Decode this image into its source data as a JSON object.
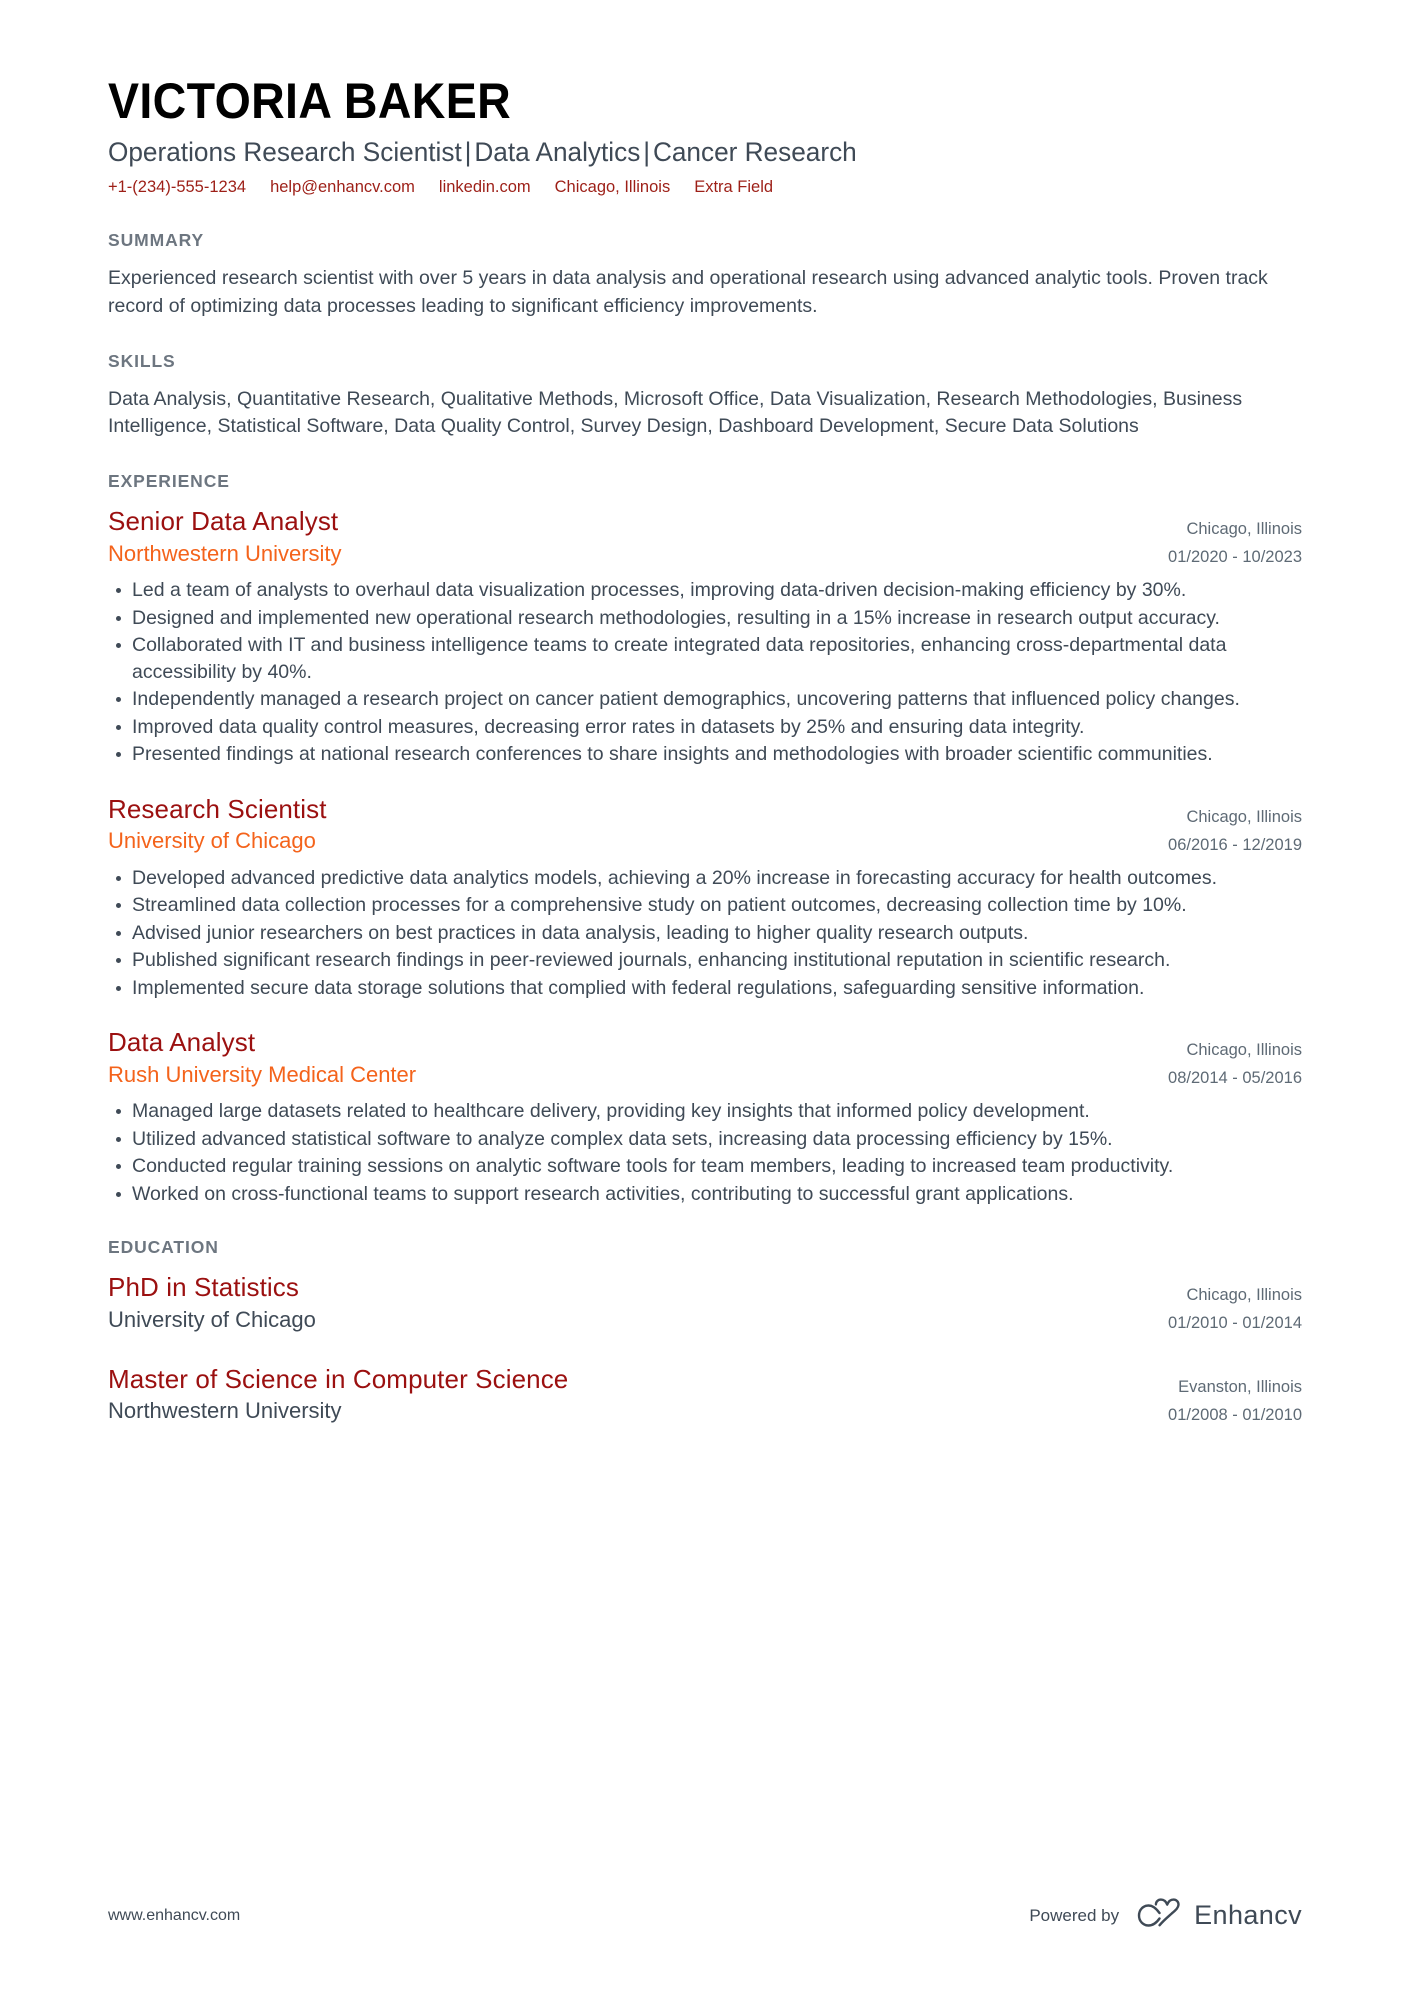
{
  "header": {
    "name": "VICTORIA BAKER",
    "headline_parts": [
      "Operations Research Scientist",
      "Data Analytics",
      "Cancer Research"
    ],
    "headline_separator": "|",
    "contacts": [
      "+1-(234)-555-1234",
      "help@enhancv.com",
      "linkedin.com",
      "Chicago, Illinois",
      "Extra Field"
    ]
  },
  "summary": {
    "title": "SUMMARY",
    "text": "Experienced research scientist with over 5 years in data analysis and operational research using advanced analytic tools. Proven track record of optimizing data processes leading to significant efficiency improvements."
  },
  "skills": {
    "title": "SKILLS",
    "text": "Data Analysis, Quantitative Research, Qualitative Methods, Microsoft Office, Data Visualization, Research Methodologies, Business Intelligence, Statistical Software, Data Quality Control, Survey Design, Dashboard Development, Secure Data Solutions"
  },
  "experience": {
    "title": "EXPERIENCE",
    "entries": [
      {
        "position": "Senior Data Analyst",
        "organization": "Northwestern University",
        "location": "Chicago, Illinois",
        "dates": "01/2020 - 10/2023",
        "bullets": [
          "Led a team of analysts to overhaul data visualization processes, improving data-driven decision-making efficiency by 30%.",
          "Designed and implemented new operational research methodologies, resulting in a 15% increase in research output accuracy.",
          "Collaborated with IT and business intelligence teams to create integrated data repositories, enhancing cross-departmental data accessibility by 40%.",
          "Independently managed a research project on cancer patient demographics, uncovering patterns that influenced policy changes.",
          "Improved data quality control measures, decreasing error rates in datasets by 25% and ensuring data integrity.",
          "Presented findings at national research conferences to share insights and methodologies with broader scientific communities."
        ]
      },
      {
        "position": "Research Scientist",
        "organization": "University of Chicago",
        "location": "Chicago, Illinois",
        "dates": "06/2016 - 12/2019",
        "bullets": [
          "Developed advanced predictive data analytics models, achieving a 20% increase in forecasting accuracy for health outcomes.",
          "Streamlined data collection processes for a comprehensive study on patient outcomes, decreasing collection time by 10%.",
          "Advised junior researchers on best practices in data analysis, leading to higher quality research outputs.",
          "Published significant research findings in peer-reviewed journals, enhancing institutional reputation in scientific research.",
          "Implemented secure data storage solutions that complied with federal regulations, safeguarding sensitive information."
        ]
      },
      {
        "position": "Data Analyst",
        "organization": "Rush University Medical Center",
        "location": "Chicago, Illinois",
        "dates": "08/2014 - 05/2016",
        "bullets": [
          "Managed large datasets related to healthcare delivery, providing key insights that informed policy development.",
          "Utilized advanced statistical software to analyze complex data sets, increasing data processing efficiency by 15%.",
          "Conducted regular training sessions on analytic software tools for team members, leading to increased team productivity.",
          "Worked on cross-functional teams to support research activities, contributing to successful grant applications."
        ]
      }
    ]
  },
  "education": {
    "title": "EDUCATION",
    "entries": [
      {
        "degree": "PhD in Statistics",
        "institution": "University of Chicago",
        "location": "Chicago, Illinois",
        "dates": "01/2010 - 01/2014"
      },
      {
        "degree": "Master of Science in Computer Science",
        "institution": "Northwestern University",
        "location": "Evanston, Illinois",
        "dates": "01/2008 - 01/2010"
      }
    ]
  },
  "footer": {
    "url": "www.enhancv.com",
    "powered_by": "Powered by",
    "brand": "Enhancv"
  },
  "colors": {
    "accent_red": "#9b1010",
    "contact_red": "#9d1f17",
    "accent_orange": "#f4631b",
    "heading_gray": "#6d7680",
    "body_gray": "#3f4a56"
  }
}
